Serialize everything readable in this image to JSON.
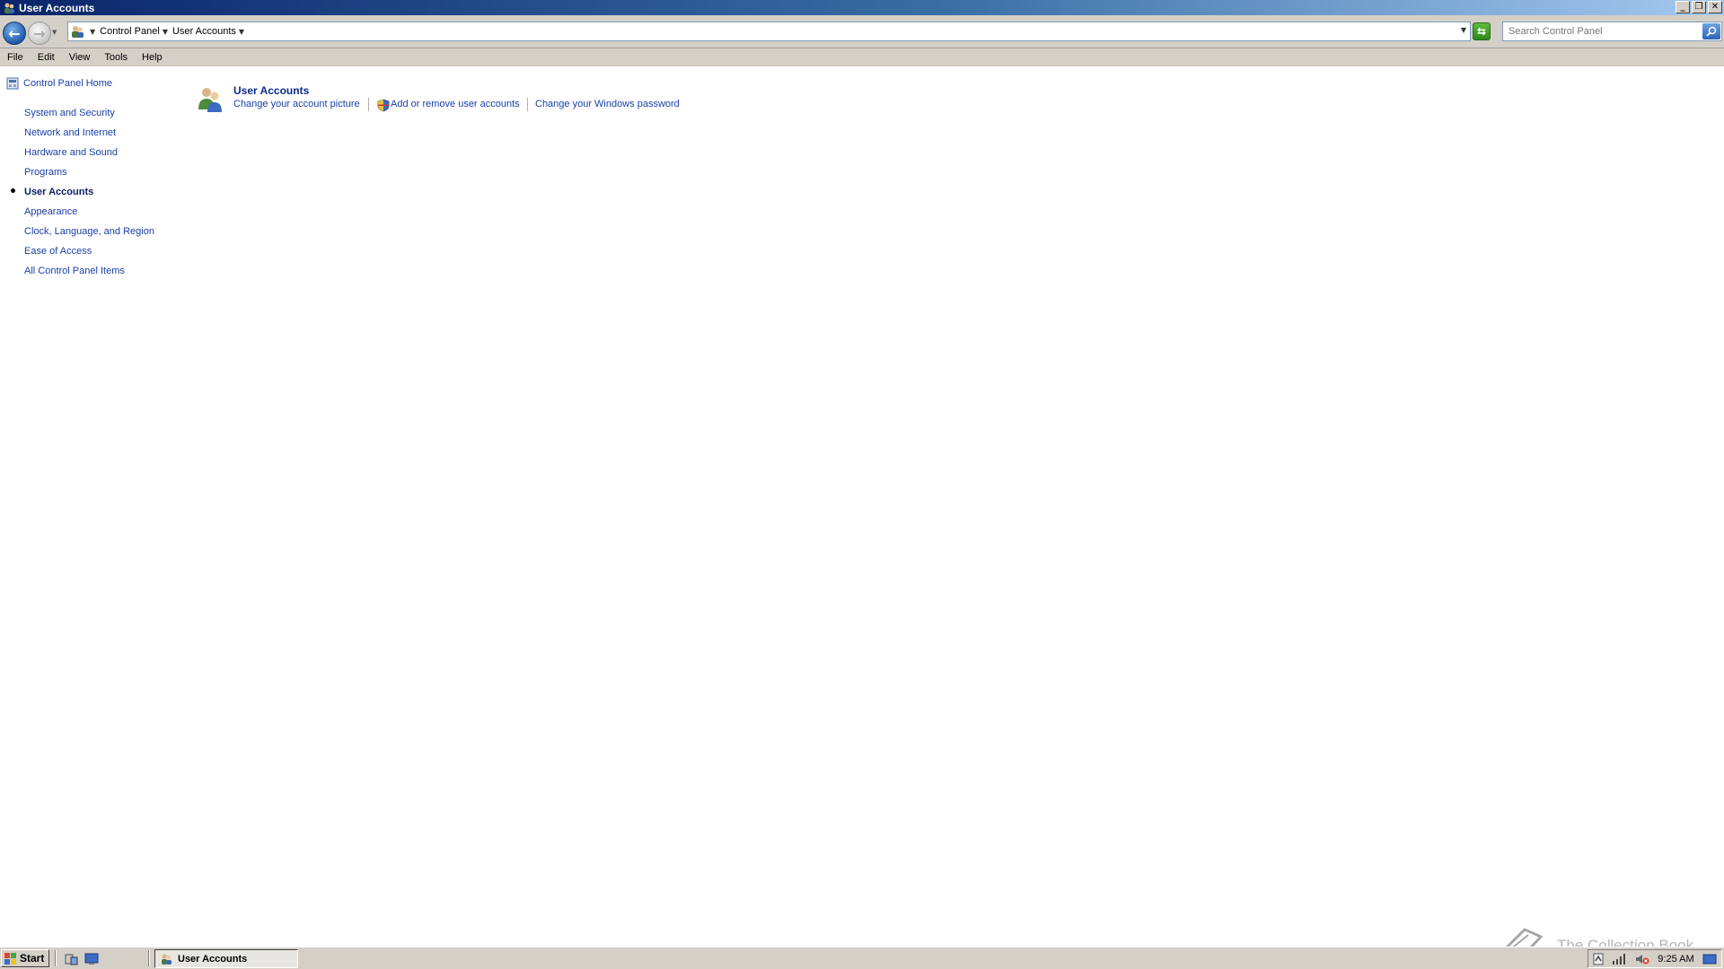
{
  "window": {
    "title": "User Accounts"
  },
  "address": {
    "crumbs": [
      "Control Panel",
      "User Accounts"
    ],
    "search_placeholder": "Search Control Panel"
  },
  "menu": [
    "File",
    "Edit",
    "View",
    "Tools",
    "Help"
  ],
  "leftnav": {
    "home": "Control Panel Home",
    "items": [
      "System and Security",
      "Network and Internet",
      "Hardware and Sound",
      "Programs",
      "User Accounts",
      "Appearance",
      "Clock, Language, and Region",
      "Ease of Access",
      "All Control Panel Items"
    ],
    "active_index": 4
  },
  "main": {
    "section_title": "User Accounts",
    "tasks": [
      "Change your account picture",
      "Add or remove user accounts",
      "Change your Windows password"
    ]
  },
  "taskbar": {
    "start_label": "Start",
    "window_button": "User Accounts",
    "clock": "9:25 AM"
  },
  "watermark": {
    "text": "The Collection Book"
  },
  "colors": {
    "link": "#1a3fa8",
    "heading": "#0b2a8a",
    "chrome": "#d4d0c8"
  }
}
